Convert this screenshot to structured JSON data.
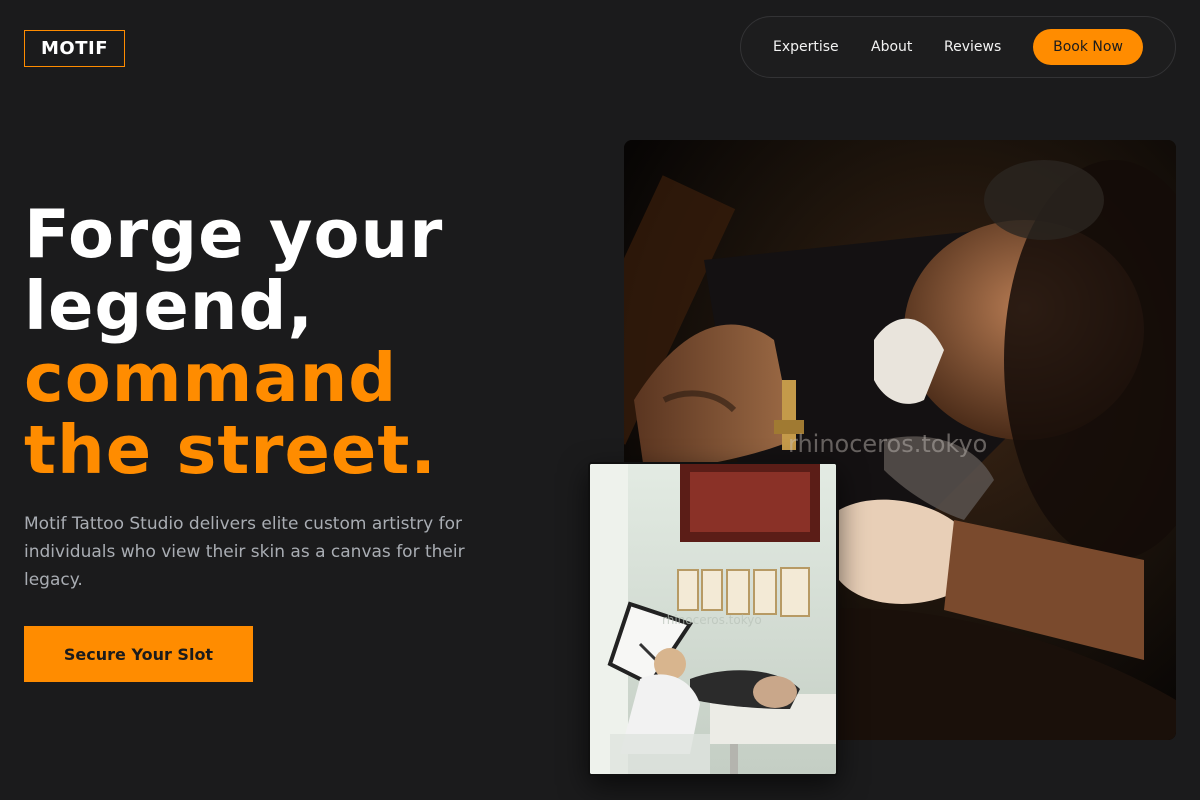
{
  "brand": {
    "logo_text": "MOTIF",
    "accent_color": "#ff8c00",
    "background_color": "#1b1b1c"
  },
  "nav": {
    "links": [
      "Expertise",
      "About",
      "Reviews"
    ],
    "cta_label": "Book Now"
  },
  "hero": {
    "headline_lines": [
      "Forge your",
      "legend,",
      "command",
      "the street."
    ],
    "description": "Motif Tattoo Studio delivers elite custom artistry for individuals who view their skin as a canvas for their legacy.",
    "cta_label": "Secure Your Slot"
  },
  "images": {
    "main": {
      "subject": "tattoo artist working closeup photo",
      "watermark": "rhinoceros.tokyo"
    },
    "inset": {
      "subject": "tattoo studio session photo",
      "watermark": "rhinoceros.tokyo"
    }
  }
}
